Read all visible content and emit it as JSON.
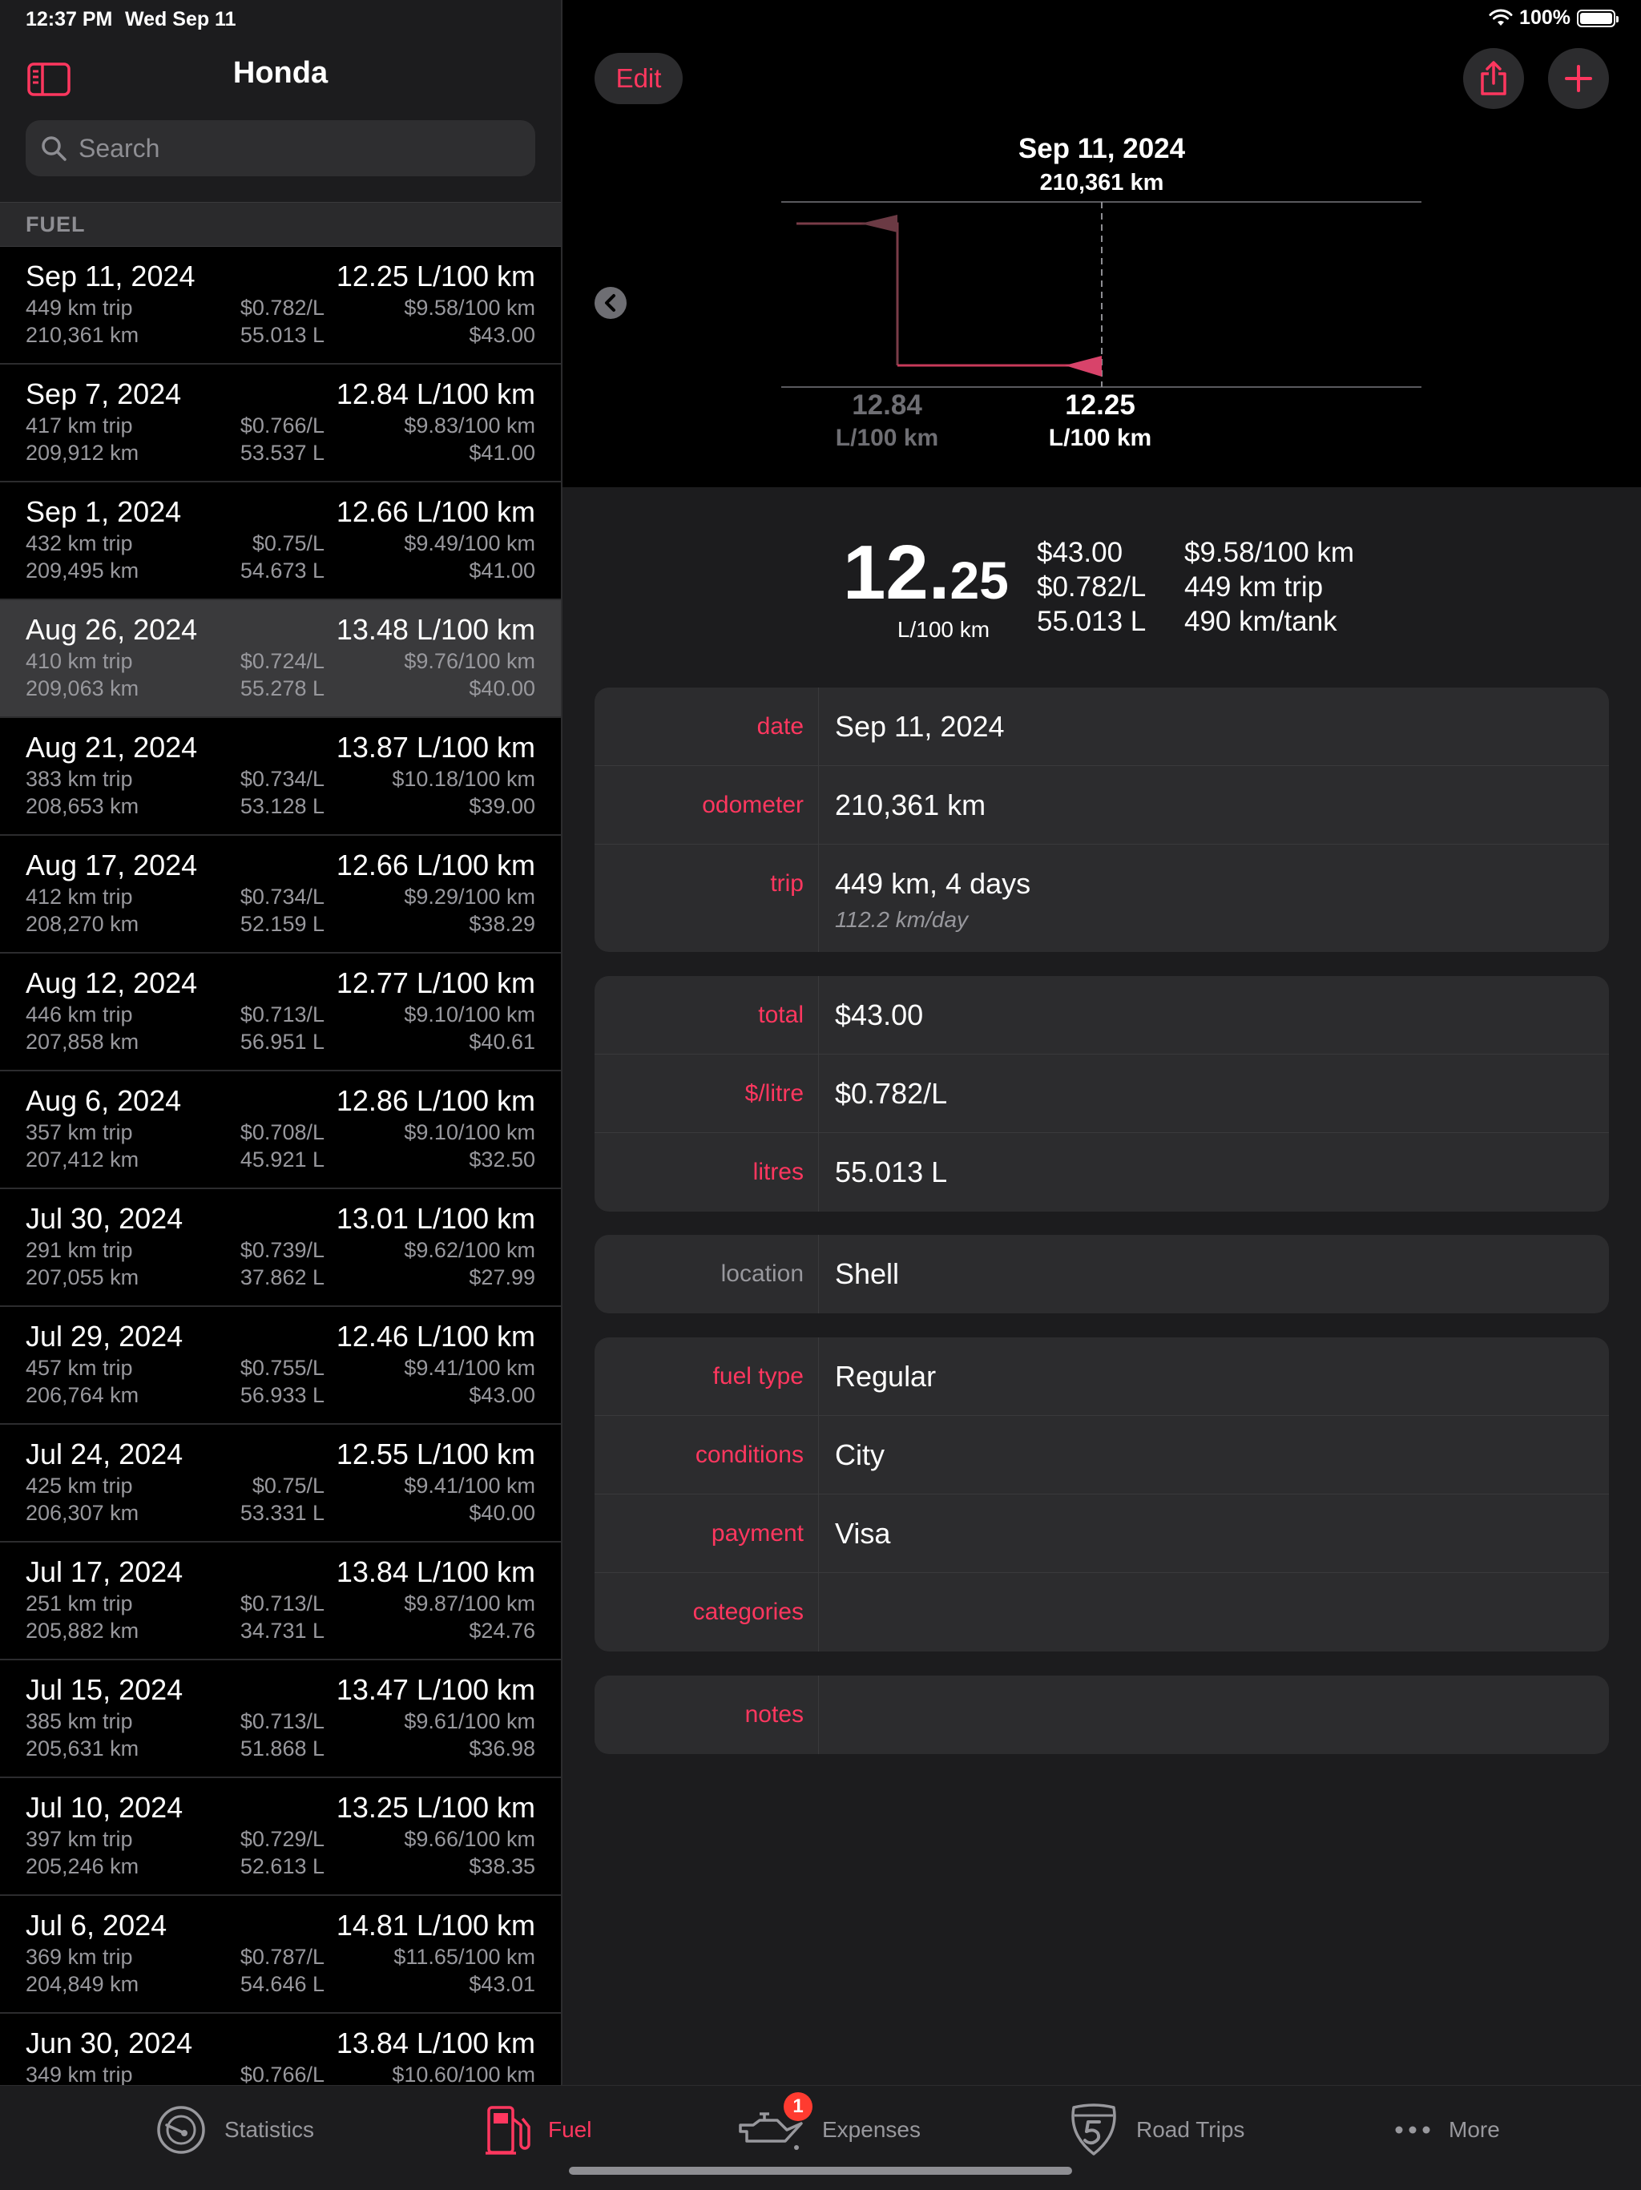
{
  "status": {
    "time": "12:37 PM",
    "date": "Wed Sep 11",
    "battery": "100%"
  },
  "sidebar": {
    "title": "Honda",
    "search_placeholder": "Search",
    "section": "FUEL",
    "rows": [
      {
        "date": "Sep 11, 2024",
        "eff": "12.25 L/100 km",
        "trip": "449 km trip",
        "odo": "210,361 km",
        "ppl": "$0.782/L",
        "litres": "55.013 L",
        "cost100": "$9.58/100 km",
        "total": "$43.00"
      },
      {
        "date": "Sep 7, 2024",
        "eff": "12.84 L/100 km",
        "trip": "417 km trip",
        "odo": "209,912 km",
        "ppl": "$0.766/L",
        "litres": "53.537 L",
        "cost100": "$9.83/100 km",
        "total": "$41.00"
      },
      {
        "date": "Sep 1, 2024",
        "eff": "12.66 L/100 km",
        "trip": "432 km trip",
        "odo": "209,495 km",
        "ppl": "$0.75/L",
        "litres": "54.673 L",
        "cost100": "$9.49/100 km",
        "total": "$41.00"
      },
      {
        "date": "Aug 26, 2024",
        "eff": "13.48 L/100 km",
        "trip": "410 km trip",
        "odo": "209,063 km",
        "ppl": "$0.724/L",
        "litres": "55.278 L",
        "cost100": "$9.76/100 km",
        "total": "$40.00"
      },
      {
        "date": "Aug 21, 2024",
        "eff": "13.87 L/100 km",
        "trip": "383 km trip",
        "odo": "208,653 km",
        "ppl": "$0.734/L",
        "litres": "53.128 L",
        "cost100": "$10.18/100 km",
        "total": "$39.00"
      },
      {
        "date": "Aug 17, 2024",
        "eff": "12.66 L/100 km",
        "trip": "412 km trip",
        "odo": "208,270 km",
        "ppl": "$0.734/L",
        "litres": "52.159 L",
        "cost100": "$9.29/100 km",
        "total": "$38.29"
      },
      {
        "date": "Aug 12, 2024",
        "eff": "12.77 L/100 km",
        "trip": "446 km trip",
        "odo": "207,858 km",
        "ppl": "$0.713/L",
        "litres": "56.951 L",
        "cost100": "$9.10/100 km",
        "total": "$40.61"
      },
      {
        "date": "Aug 6, 2024",
        "eff": "12.86 L/100 km",
        "trip": "357 km trip",
        "odo": "207,412 km",
        "ppl": "$0.708/L",
        "litres": "45.921 L",
        "cost100": "$9.10/100 km",
        "total": "$32.50"
      },
      {
        "date": "Jul 30, 2024",
        "eff": "13.01 L/100 km",
        "trip": "291 km trip",
        "odo": "207,055 km",
        "ppl": "$0.739/L",
        "litres": "37.862 L",
        "cost100": "$9.62/100 km",
        "total": "$27.99"
      },
      {
        "date": "Jul 29, 2024",
        "eff": "12.46 L/100 km",
        "trip": "457 km trip",
        "odo": "206,764 km",
        "ppl": "$0.755/L",
        "litres": "56.933 L",
        "cost100": "$9.41/100 km",
        "total": "$43.00"
      },
      {
        "date": "Jul 24, 2024",
        "eff": "12.55 L/100 km",
        "trip": "425 km trip",
        "odo": "206,307 km",
        "ppl": "$0.75/L",
        "litres": "53.331 L",
        "cost100": "$9.41/100 km",
        "total": "$40.00"
      },
      {
        "date": "Jul 17, 2024",
        "eff": "13.84 L/100 km",
        "trip": "251 km trip",
        "odo": "205,882 km",
        "ppl": "$0.713/L",
        "litres": "34.731 L",
        "cost100": "$9.87/100 km",
        "total": "$24.76"
      },
      {
        "date": "Jul 15, 2024",
        "eff": "13.47 L/100 km",
        "trip": "385 km trip",
        "odo": "205,631 km",
        "ppl": "$0.713/L",
        "litres": "51.868 L",
        "cost100": "$9.61/100 km",
        "total": "$36.98"
      },
      {
        "date": "Jul 10, 2024",
        "eff": "13.25 L/100 km",
        "trip": "397 km trip",
        "odo": "205,246 km",
        "ppl": "$0.729/L",
        "litres": "52.613 L",
        "cost100": "$9.66/100 km",
        "total": "$38.35"
      },
      {
        "date": "Jul 6, 2024",
        "eff": "14.81 L/100 km",
        "trip": "369 km trip",
        "odo": "204,849 km",
        "ppl": "$0.787/L",
        "litres": "54.646 L",
        "cost100": "$11.65/100 km",
        "total": "$43.01"
      },
      {
        "date": "Jun 30, 2024",
        "eff": "13.84 L/100 km",
        "trip": "349 km trip",
        "odo": "",
        "ppl": "$0.766/L",
        "litres": "",
        "cost100": "$10.60/100 km",
        "total": ""
      }
    ]
  },
  "toolbar": {
    "edit_label": "Edit"
  },
  "chart": {
    "header_date": "Sep 11, 2024",
    "header_odo": "210,361 km",
    "prev_value": "12.84",
    "prev_unit": "L/100 km",
    "cur_value": "12.25",
    "cur_unit": "L/100 km"
  },
  "summary": {
    "int": "12.",
    "dec": "25",
    "unit": "L/100 km",
    "col1": [
      "$43.00",
      "$0.782/L",
      "55.013 L"
    ],
    "col2": [
      "$9.58/100 km",
      "449 km trip",
      "490 km/tank"
    ]
  },
  "details": {
    "date": {
      "label": "date",
      "value": "Sep 11, 2024"
    },
    "odometer": {
      "label": "odometer",
      "value": "210,361 km"
    },
    "trip": {
      "label": "trip",
      "value": "449 km, 4 days",
      "sub": "112.2 km/day"
    },
    "total": {
      "label": "total",
      "value": "$43.00"
    },
    "ppl": {
      "label": "$/litre",
      "value": "$0.782/L"
    },
    "litres": {
      "label": "litres",
      "value": "55.013 L"
    },
    "location": {
      "label": "location",
      "value": "Shell"
    },
    "fuel_type": {
      "label": "fuel type",
      "value": "Regular"
    },
    "conditions": {
      "label": "conditions",
      "value": "City"
    },
    "payment": {
      "label": "payment",
      "value": "Visa"
    },
    "categories": {
      "label": "categories",
      "value": ""
    },
    "notes": {
      "label": "notes",
      "value": ""
    }
  },
  "tabs": {
    "statistics": "Statistics",
    "fuel": "Fuel",
    "expenses": "Expenses",
    "expenses_badge": "1",
    "road_trips": "Road Trips",
    "more": "More"
  },
  "colors": {
    "accent": "#ff375f",
    "background": "#000000",
    "panel": "#1c1c1e",
    "card": "#2c2c2e"
  },
  "icons": [
    "sidebar-icon",
    "search-icon",
    "share-icon",
    "plus-icon",
    "chevron-left-icon",
    "gauge-icon",
    "fuel-pump-icon",
    "oil-can-icon",
    "highway-shield-icon",
    "ellipsis-icon",
    "wifi-icon",
    "battery-icon"
  ]
}
